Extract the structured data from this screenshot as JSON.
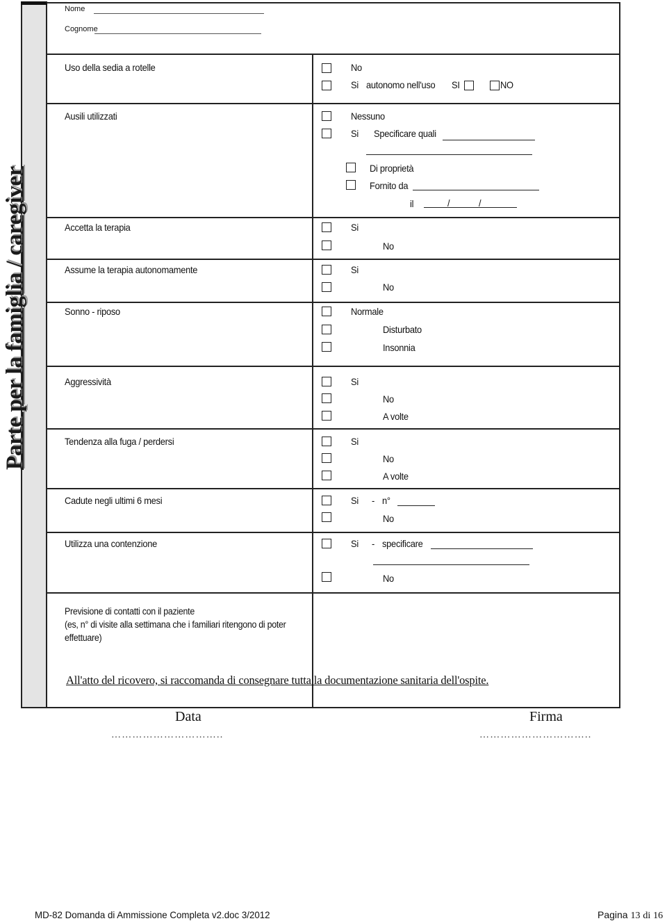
{
  "sidebar": {
    "title": "Parte per la famiglia / caregiver"
  },
  "header": {
    "nome_label": "Nome",
    "cognome_label": "Cognome"
  },
  "rows": {
    "sedia": {
      "label": "Uso della sedia a rotelle",
      "options": [
        "No",
        "Si",
        "autonomo nell'uso",
        "SI",
        "NO"
      ]
    },
    "ausili": {
      "label": "Ausili utilizzati",
      "options": [
        "Nessuno",
        "Si",
        "Specificare quali",
        "Di proprietà",
        "Fornito da",
        "il",
        "/",
        "/"
      ]
    },
    "accetta": {
      "label": "Accetta la terapia",
      "options": [
        "Si",
        "No"
      ]
    },
    "assume": {
      "label": "Assume la terapia autonomamente",
      "options": [
        "Si",
        "No"
      ]
    },
    "sonno": {
      "label": "Sonno - riposo",
      "options": [
        "Normale",
        "Disturbato",
        "Insonnia"
      ]
    },
    "aggressivita": {
      "label": "Aggressività",
      "options": [
        "Si",
        "No",
        "A volte"
      ]
    },
    "fuga": {
      "label": "Tendenza alla fuga / perdersi",
      "options": [
        "Si",
        "No",
        "A volte"
      ]
    },
    "cadute": {
      "label": "Cadute negli ultimi 6 mesi",
      "options": [
        "Si",
        "-",
        "n°",
        "No"
      ]
    },
    "contenzione": {
      "label": "Utilizza una contenzione",
      "options": [
        "Si",
        "-",
        "specificare",
        "No"
      ]
    },
    "contatti": {
      "line1": "Previsione di contatti con il paziente",
      "line2": "(es, n° di visite alla settimana che i familiari ritengono di poter",
      "line3": "effettuare)"
    }
  },
  "note": "All'atto del ricovero, si raccomanda di consegnare tutta la documentazione sanitaria dell'ospite.",
  "signature": {
    "data_label": "Data",
    "firma_label": "Firma",
    "data_dots": "…………………………..",
    "firma_dots": "………………………….."
  },
  "footer": {
    "doc": "MD-82 Domanda di Ammissione Completa v2.doc 3/2012",
    "page_label": "Pagina",
    "page_current": "13",
    "page_sep": "di",
    "page_total": "16"
  }
}
